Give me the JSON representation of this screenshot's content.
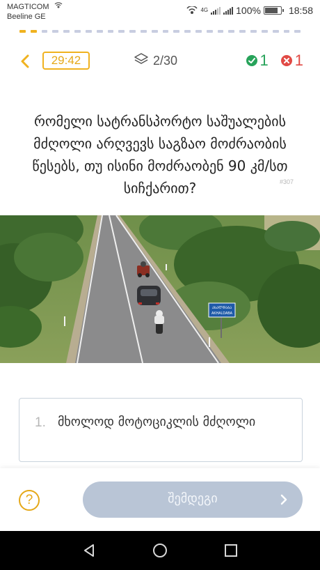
{
  "status_bar": {
    "carrier_1": "MAGTICOM",
    "carrier_2": "Beeline GE",
    "network": "4G",
    "battery": "100%",
    "time": "18:58"
  },
  "progress": {
    "answered_segments": 2,
    "total_segments": 30
  },
  "header": {
    "back_icon": "chevron-left-icon",
    "timer": "29:42",
    "counter": "2/30",
    "counter_icon": "layers-icon",
    "correct": "1",
    "wrong": "1"
  },
  "question": {
    "text": "რომელი სატრანსპორტო საშუალების მძღოლი არღვევს საგზაო მოძრაობის წესებს, თუ ისინი მოძრაობენ 90 კმ/სთ სიჩქარით?",
    "id": "#307"
  },
  "scene": {
    "sign_line_1": "ᲐᲮᲐᲚᲓᲐᲑᲐ",
    "sign_line_2": "AKHALDABA"
  },
  "answer": {
    "number": "1.",
    "text": "მხოლოდ მოტოციკლის მძღოლი"
  },
  "footer": {
    "help_label": "?",
    "next_label": "შემდეგი"
  },
  "colors": {
    "accent": "#f0b21f",
    "correct": "#27a35a",
    "wrong": "#e14a45",
    "button_disabled": "#b9c5d6",
    "progress_inactive": "#c8cde0"
  }
}
